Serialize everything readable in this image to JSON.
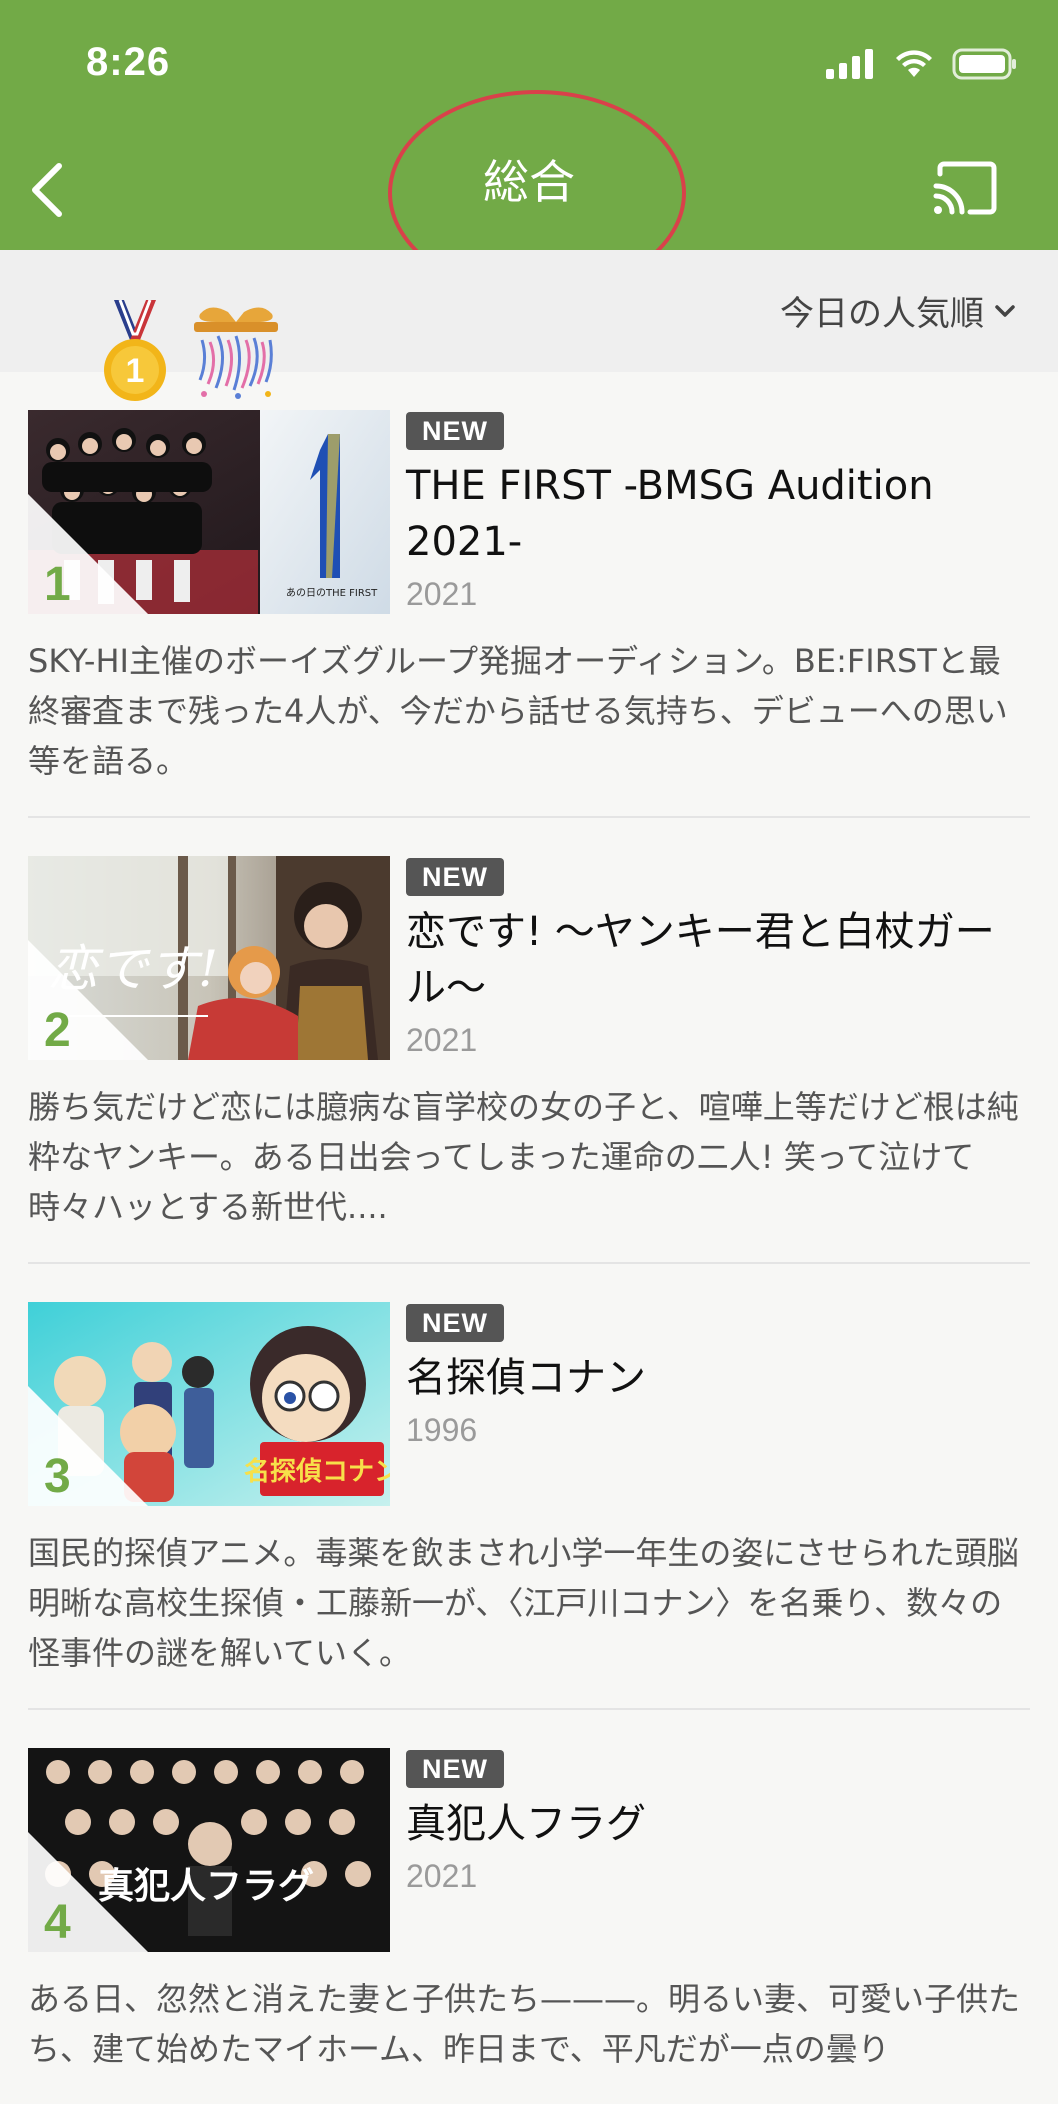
{
  "status": {
    "time": "8:26"
  },
  "nav": {
    "title": "総合"
  },
  "sort": {
    "label": "今日の人気順"
  },
  "items": [
    {
      "rank": "1",
      "badge": "NEW",
      "title": "THE FIRST -BMSG Audition 2021-",
      "year": "2021",
      "description": "SKY-HI主催のボーイズグループ発掘オーディション。BE:FIRSTと最終審査まで残った4人が、今だから話せる気持ち、デビューへの思い等を語る。",
      "thumb_text": "あの日のTHE FIRST"
    },
    {
      "rank": "2",
      "badge": "NEW",
      "title": "恋です! 〜ヤンキー君と白杖ガール〜",
      "year": "2021",
      "description": "勝ち気だけど恋には臆病な盲学校の女の子と、喧嘩上等だけど根は純粋なヤンキー。ある日出会ってしまった運命の二人! 笑って泣けて時々ハッとする新世代....",
      "thumb_text": "恋です!"
    },
    {
      "rank": "3",
      "badge": "NEW",
      "title": "名探偵コナン",
      "year": "1996",
      "description": "国民的探偵アニメ。毒薬を飲まされ小学一年生の姿にさせられた頭脳明晰な高校生探偵・工藤新一が、〈江戸川コナン〉を名乗り、数々の怪事件の謎を解いていく。",
      "thumb_text": "名探偵コナン"
    },
    {
      "rank": "4",
      "badge": "NEW",
      "title": "真犯人フラグ",
      "year": "2021",
      "description": "ある日、忽然と消えた妻と子供たち———。明るい妻、可愛い子供たち、建て始めたマイホーム、昨日まで、平凡だが一点の曇り",
      "thumb_text": "真犯人フラグ"
    }
  ]
}
